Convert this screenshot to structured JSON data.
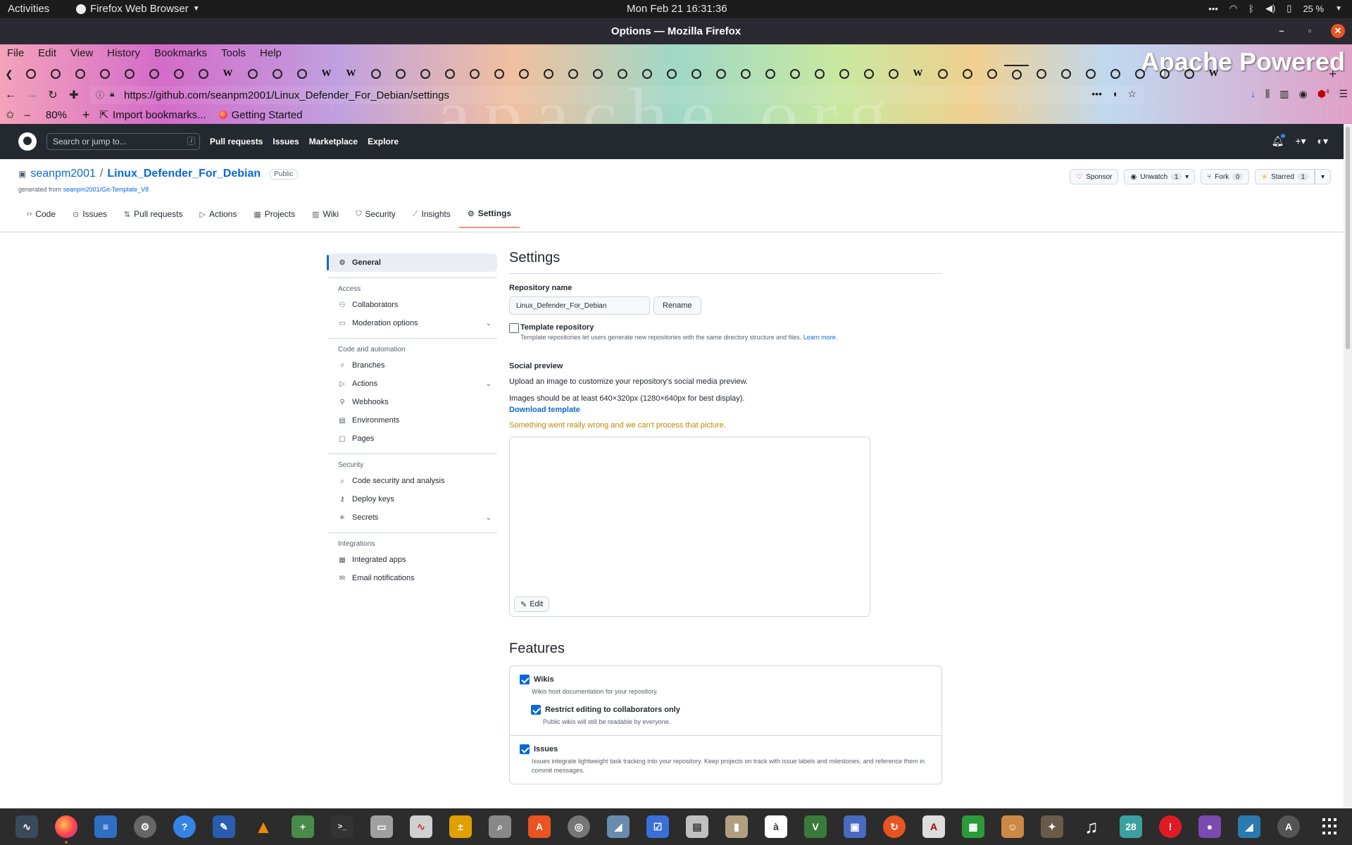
{
  "system": {
    "activities": "Activities",
    "app_menu": "Firefox Web Browser",
    "clock": "Mon Feb 21  16:31:36",
    "battery": "25 %"
  },
  "window": {
    "title": "Options — Mozilla Firefox"
  },
  "firefox": {
    "menu": [
      "File",
      "Edit",
      "View",
      "History",
      "Bookmarks",
      "Tools",
      "Help"
    ],
    "theme_banner": "Apache Powered",
    "theme_watermark": "apache.org",
    "tabs": [
      "gh",
      "gh",
      "gh",
      "gh",
      "gh",
      "gh",
      "gh",
      "gh",
      "w",
      "gh",
      "gh",
      "gh",
      "w",
      "w",
      "gh",
      "gh",
      "gh",
      "gh",
      "gh",
      "gh",
      "gh",
      "gh",
      "gh",
      "gh",
      "gh",
      "gh",
      "gh",
      "gh",
      "gh",
      "gh",
      "gh",
      "gh",
      "gh",
      "gh",
      "gh",
      "gh",
      "w",
      "gh",
      "gh",
      "gh",
      "gh",
      "gh",
      "gh",
      "gh",
      "gh",
      "gh",
      "gh",
      "gh",
      "w"
    ],
    "url": "https://github.com/seanpm2001/Linux_Defender_For_Debian/settings",
    "zoom": "80%",
    "bookmarks": [
      "Import bookmarks...",
      "Getting Started"
    ],
    "ublock_count": "4"
  },
  "github": {
    "search_placeholder": "Search or jump to...",
    "search_key": "/",
    "nav": [
      "Pull requests",
      "Issues",
      "Marketplace",
      "Explore"
    ],
    "repo": {
      "owner": "seanpm2001",
      "separator": "/",
      "name": "Linux_Defender_For_Debian",
      "visibility": "Public",
      "generated_prefix": "generated from",
      "generated_from": "seanpm2001/Git-Template_V8"
    },
    "actions": {
      "sponsor": "Sponsor",
      "unwatch": "Unwatch",
      "unwatch_count": "1",
      "fork": "Fork",
      "fork_count": "0",
      "starred": "Starred",
      "starred_count": "1"
    },
    "tabs": [
      "Code",
      "Issues",
      "Pull requests",
      "Actions",
      "Projects",
      "Wiki",
      "Security",
      "Insights",
      "Settings"
    ]
  },
  "sidebar": {
    "general": "General",
    "groups": {
      "access": "Access",
      "code": "Code and automation",
      "security": "Security",
      "integrations": "Integrations"
    },
    "access_items": [
      "Collaborators",
      "Moderation options"
    ],
    "code_items": [
      "Branches",
      "Actions",
      "Webhooks",
      "Environments",
      "Pages"
    ],
    "security_items": [
      "Code security and analysis",
      "Deploy keys",
      "Secrets"
    ],
    "integration_items": [
      "Integrated apps",
      "Email notifications"
    ]
  },
  "settings": {
    "title": "Settings",
    "repo_name_label": "Repository name",
    "repo_name_value": "Linux_Defender_For_Debian",
    "rename": "Rename",
    "template_label": "Template repository",
    "template_note": "Template repositories let users generate new repositories with the same directory structure and files.",
    "learn_more": "Learn more.",
    "social_title": "Social preview",
    "social_desc": "Upload an image to customize your repository's social media preview.",
    "social_size": "Images should be at least 640×320px (1280×640px for best display).",
    "download_template": "Download template",
    "error": "Something went really wrong and we can't process that picture.",
    "edit": "Edit",
    "features_title": "Features",
    "wikis": "Wikis",
    "wikis_desc": "Wikis host documentation for your repository.",
    "restrict": "Restrict editing to collaborators only",
    "restrict_desc": "Public wikis will still be readable by everyone.",
    "issues": "Issues",
    "issues_desc": "Issues integrate lightweight task tracking into your repository. Keep projects on track with issue labels and milestones, and reference them in commit messages."
  },
  "dock": {
    "calendar_day": "28"
  },
  "colors": {
    "gh_header": "#24292f",
    "link": "#0969da",
    "error": "#bf8700",
    "selected_tab": "#fd8c73",
    "ubuntu_orange": "#e95420"
  }
}
